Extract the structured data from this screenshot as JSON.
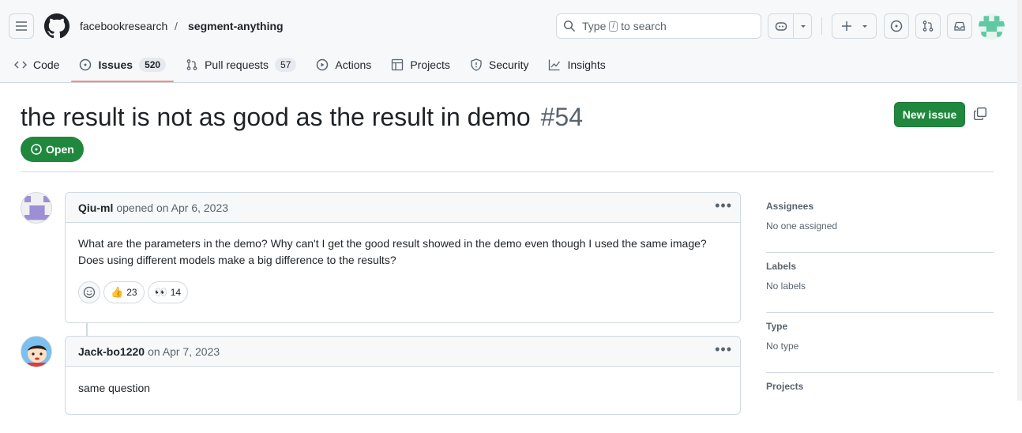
{
  "header": {
    "owner": "facebookresearch",
    "separator": "/",
    "repo": "segment-anything",
    "search": {
      "prefix": "Type",
      "key": "/",
      "suffix": "to search"
    }
  },
  "tabs": [
    {
      "label": "Code",
      "count": null
    },
    {
      "label": "Issues",
      "count": "520",
      "active": true
    },
    {
      "label": "Pull requests",
      "count": "57"
    },
    {
      "label": "Actions"
    },
    {
      "label": "Projects"
    },
    {
      "label": "Security"
    },
    {
      "label": "Insights"
    }
  ],
  "issue": {
    "title": "the result is not as good as the result in demo",
    "number": "#54",
    "state": "Open",
    "new_issue_label": "New issue"
  },
  "comments": [
    {
      "author": "Qiu-ml",
      "meta": "opened on Apr 6, 2023",
      "body_line1": "What are the parameters in the demo? Why can't I get the good result showed in the demo even though I used the same image?",
      "body_line2": "Does using different models make a big difference to the results?",
      "reactions": [
        {
          "emoji": "👍",
          "count": "23"
        },
        {
          "emoji": "👀",
          "count": "14"
        }
      ]
    },
    {
      "author": "Jack-bo1220",
      "meta": "on Apr 7, 2023",
      "body_line1": "same question"
    }
  ],
  "sidebar": [
    {
      "title": "Assignees",
      "value": "No one assigned"
    },
    {
      "title": "Labels",
      "value": "No labels"
    },
    {
      "title": "Type",
      "value": "No type"
    },
    {
      "title": "Projects",
      "value": ""
    }
  ],
  "colors": {
    "accent_green": "#1f883d",
    "tab_underline": "#fd8c73",
    "border": "#d1d9e0"
  }
}
